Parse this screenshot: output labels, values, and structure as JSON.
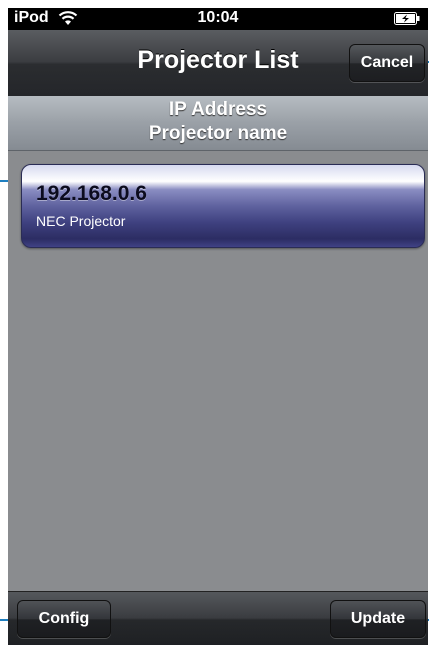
{
  "status_bar": {
    "carrier": "iPod",
    "time": "10:04",
    "wifi_icon": "wifi-icon",
    "battery_icon": "battery-charging-icon"
  },
  "nav_bar": {
    "title": "Projector List",
    "cancel_label": "Cancel"
  },
  "list_header": {
    "line1": "IP Address",
    "line2": "Projector name"
  },
  "projectors": [
    {
      "ip": "192.168.0.6",
      "name": "NEC Projector"
    }
  ],
  "toolbar": {
    "config_label": "Config",
    "update_label": "Update"
  },
  "colors": {
    "callout": "#1f7fc0",
    "selected_row": "#4b4e90",
    "background": "#8a8c8f"
  }
}
